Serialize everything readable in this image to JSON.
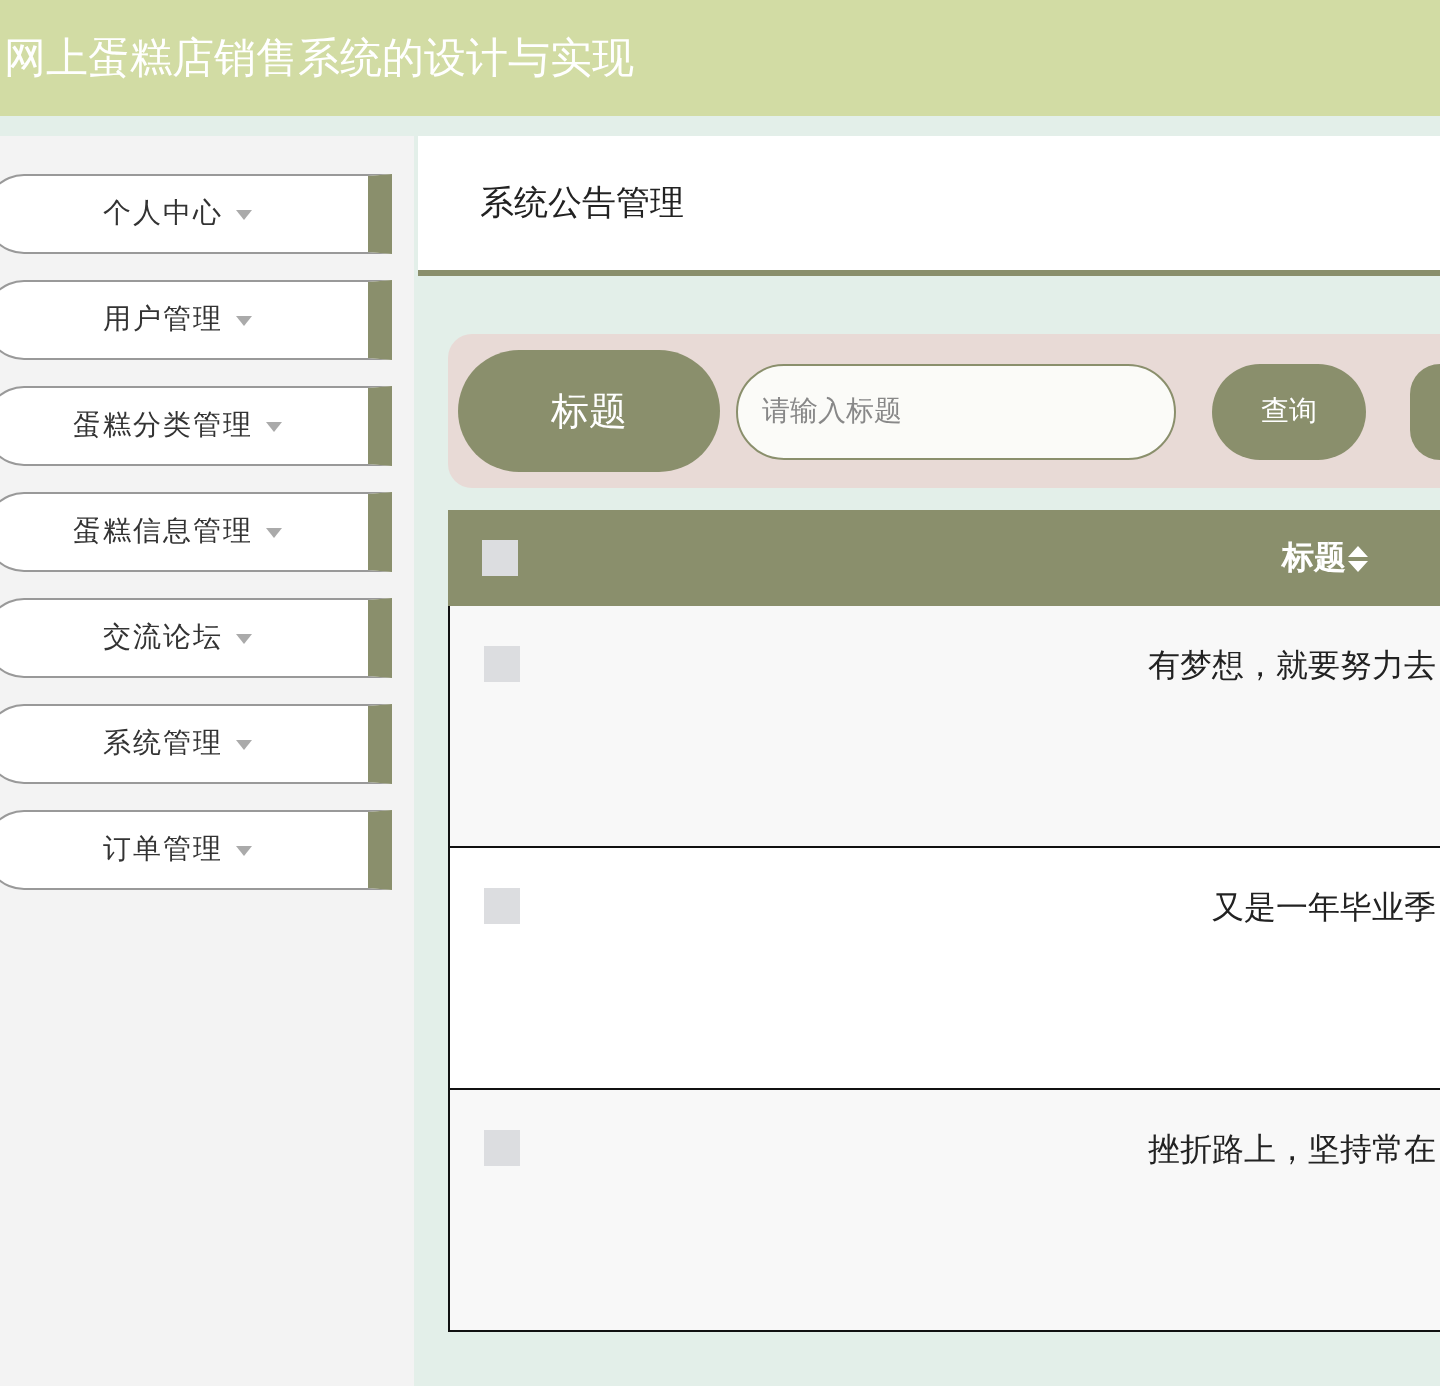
{
  "header": {
    "title": "网上蛋糕店销售系统的设计与实现"
  },
  "sidebar": {
    "items": [
      {
        "label": "个人中心",
        "expanded": false
      },
      {
        "label": "用户管理",
        "expanded": false
      },
      {
        "label": "蛋糕分类管理",
        "expanded": false
      },
      {
        "label": "蛋糕信息管理",
        "expanded": false
      },
      {
        "label": "交流论坛",
        "expanded": false
      },
      {
        "label": "系统管理",
        "expanded": false
      },
      {
        "label": "订单管理",
        "expanded": false
      }
    ]
  },
  "page_title": "系统公告管理",
  "search": {
    "label": "标题",
    "placeholder": "请输入标题",
    "button": "查询"
  },
  "table": {
    "select_all_checked": false,
    "columns": [
      {
        "label": "标题",
        "sortable": true
      }
    ],
    "rows": [
      {
        "checked": false,
        "title": "有梦想，就要努力去"
      },
      {
        "checked": false,
        "title": "又是一年毕业季"
      },
      {
        "checked": false,
        "title": "挫折路上，坚持常在"
      }
    ]
  }
}
